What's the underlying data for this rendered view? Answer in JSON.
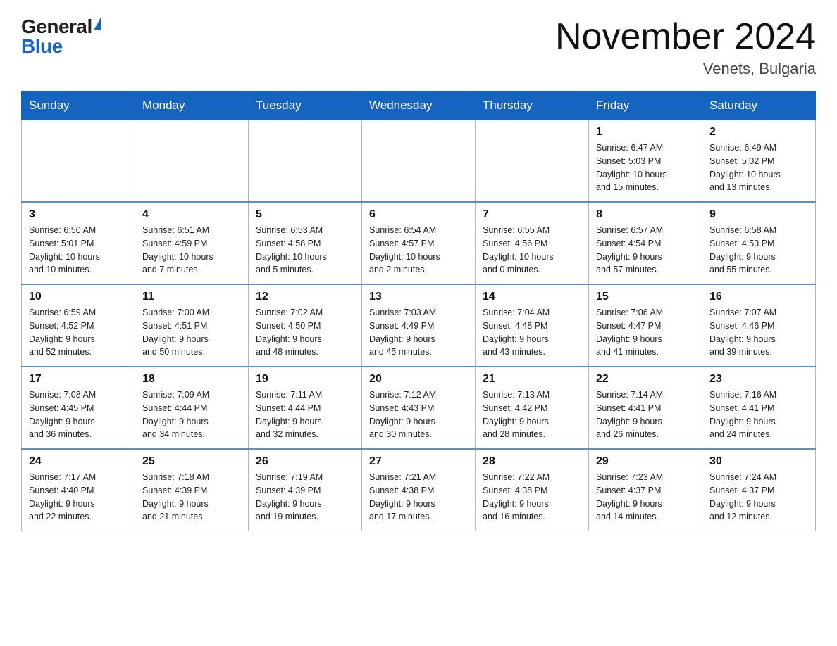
{
  "logo": {
    "general": "General",
    "blue": "Blue"
  },
  "title": "November 2024",
  "location": "Venets, Bulgaria",
  "weekdays": [
    "Sunday",
    "Monday",
    "Tuesday",
    "Wednesday",
    "Thursday",
    "Friday",
    "Saturday"
  ],
  "weeks": [
    [
      {
        "day": "",
        "info": ""
      },
      {
        "day": "",
        "info": ""
      },
      {
        "day": "",
        "info": ""
      },
      {
        "day": "",
        "info": ""
      },
      {
        "day": "",
        "info": ""
      },
      {
        "day": "1",
        "info": "Sunrise: 6:47 AM\nSunset: 5:03 PM\nDaylight: 10 hours\nand 15 minutes."
      },
      {
        "day": "2",
        "info": "Sunrise: 6:49 AM\nSunset: 5:02 PM\nDaylight: 10 hours\nand 13 minutes."
      }
    ],
    [
      {
        "day": "3",
        "info": "Sunrise: 6:50 AM\nSunset: 5:01 PM\nDaylight: 10 hours\nand 10 minutes."
      },
      {
        "day": "4",
        "info": "Sunrise: 6:51 AM\nSunset: 4:59 PM\nDaylight: 10 hours\nand 7 minutes."
      },
      {
        "day": "5",
        "info": "Sunrise: 6:53 AM\nSunset: 4:58 PM\nDaylight: 10 hours\nand 5 minutes."
      },
      {
        "day": "6",
        "info": "Sunrise: 6:54 AM\nSunset: 4:57 PM\nDaylight: 10 hours\nand 2 minutes."
      },
      {
        "day": "7",
        "info": "Sunrise: 6:55 AM\nSunset: 4:56 PM\nDaylight: 10 hours\nand 0 minutes."
      },
      {
        "day": "8",
        "info": "Sunrise: 6:57 AM\nSunset: 4:54 PM\nDaylight: 9 hours\nand 57 minutes."
      },
      {
        "day": "9",
        "info": "Sunrise: 6:58 AM\nSunset: 4:53 PM\nDaylight: 9 hours\nand 55 minutes."
      }
    ],
    [
      {
        "day": "10",
        "info": "Sunrise: 6:59 AM\nSunset: 4:52 PM\nDaylight: 9 hours\nand 52 minutes."
      },
      {
        "day": "11",
        "info": "Sunrise: 7:00 AM\nSunset: 4:51 PM\nDaylight: 9 hours\nand 50 minutes."
      },
      {
        "day": "12",
        "info": "Sunrise: 7:02 AM\nSunset: 4:50 PM\nDaylight: 9 hours\nand 48 minutes."
      },
      {
        "day": "13",
        "info": "Sunrise: 7:03 AM\nSunset: 4:49 PM\nDaylight: 9 hours\nand 45 minutes."
      },
      {
        "day": "14",
        "info": "Sunrise: 7:04 AM\nSunset: 4:48 PM\nDaylight: 9 hours\nand 43 minutes."
      },
      {
        "day": "15",
        "info": "Sunrise: 7:06 AM\nSunset: 4:47 PM\nDaylight: 9 hours\nand 41 minutes."
      },
      {
        "day": "16",
        "info": "Sunrise: 7:07 AM\nSunset: 4:46 PM\nDaylight: 9 hours\nand 39 minutes."
      }
    ],
    [
      {
        "day": "17",
        "info": "Sunrise: 7:08 AM\nSunset: 4:45 PM\nDaylight: 9 hours\nand 36 minutes."
      },
      {
        "day": "18",
        "info": "Sunrise: 7:09 AM\nSunset: 4:44 PM\nDaylight: 9 hours\nand 34 minutes."
      },
      {
        "day": "19",
        "info": "Sunrise: 7:11 AM\nSunset: 4:44 PM\nDaylight: 9 hours\nand 32 minutes."
      },
      {
        "day": "20",
        "info": "Sunrise: 7:12 AM\nSunset: 4:43 PM\nDaylight: 9 hours\nand 30 minutes."
      },
      {
        "day": "21",
        "info": "Sunrise: 7:13 AM\nSunset: 4:42 PM\nDaylight: 9 hours\nand 28 minutes."
      },
      {
        "day": "22",
        "info": "Sunrise: 7:14 AM\nSunset: 4:41 PM\nDaylight: 9 hours\nand 26 minutes."
      },
      {
        "day": "23",
        "info": "Sunrise: 7:16 AM\nSunset: 4:41 PM\nDaylight: 9 hours\nand 24 minutes."
      }
    ],
    [
      {
        "day": "24",
        "info": "Sunrise: 7:17 AM\nSunset: 4:40 PM\nDaylight: 9 hours\nand 22 minutes."
      },
      {
        "day": "25",
        "info": "Sunrise: 7:18 AM\nSunset: 4:39 PM\nDaylight: 9 hours\nand 21 minutes."
      },
      {
        "day": "26",
        "info": "Sunrise: 7:19 AM\nSunset: 4:39 PM\nDaylight: 9 hours\nand 19 minutes."
      },
      {
        "day": "27",
        "info": "Sunrise: 7:21 AM\nSunset: 4:38 PM\nDaylight: 9 hours\nand 17 minutes."
      },
      {
        "day": "28",
        "info": "Sunrise: 7:22 AM\nSunset: 4:38 PM\nDaylight: 9 hours\nand 16 minutes."
      },
      {
        "day": "29",
        "info": "Sunrise: 7:23 AM\nSunset: 4:37 PM\nDaylight: 9 hours\nand 14 minutes."
      },
      {
        "day": "30",
        "info": "Sunrise: 7:24 AM\nSunset: 4:37 PM\nDaylight: 9 hours\nand 12 minutes."
      }
    ]
  ]
}
